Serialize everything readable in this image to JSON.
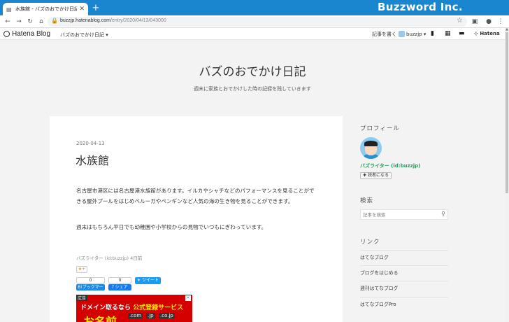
{
  "browser": {
    "tab_title": "水族館 - バズのおでかけ日記",
    "new_tab": "+",
    "brand": "Buzzword Inc.",
    "url_host": "buzzjp.hatenablog.com",
    "url_path": "/entry/2020/04/13/043000"
  },
  "hatena_bar": {
    "logo": "Hatena Blog",
    "blog_menu": "バズのおでかけ日記",
    "write_article": "記事を書く",
    "user": "buzzjp",
    "hatena": "Hatena"
  },
  "blog": {
    "title": "バズのおでかけ日記",
    "description": "週末に家族とおでかけした時の記録を残していきます"
  },
  "entry": {
    "date": "2020-04-13",
    "title": "水族館",
    "paragraph1": "名古屋市港区には名古屋港水族館があります。イルカやシャチなどのパフォーマンスを見ることができる屋外プールをはじめベルーガやペンギンなど人気の海の生き物を見ることができます。",
    "paragraph2": "週末はもちろん平日でも幼稚園や小学校からの見物でいつもにぎわっています。",
    "author_line": "バズライター (id:buzzjp) 4日前",
    "star": "★+",
    "bookmark_count": "0",
    "bookmark_label": "B!ブックマーク",
    "facebook_count": "0",
    "facebook_label": "f シェア",
    "tweet_label": "ツイート"
  },
  "ad": {
    "tag": "広告",
    "line1_a": "ドメイン取るなら",
    "line1_b": "公式登録サービス",
    "brand": "お名前",
    "tld1": ".com",
    "tld2": ".jp",
    "tld3": ".co.jp"
  },
  "sidebar": {
    "profile_heading": "プロフィール",
    "profile_name": "バズライター (id:buzzjp)",
    "follow_label": "読者になる",
    "search_heading": "検索",
    "search_placeholder": "記事を検索",
    "links_heading": "リンク",
    "links": [
      "はてなブログ",
      "ブログをはじめる",
      "週刊はてなブログ",
      "はてなブログPro"
    ]
  },
  "colors": {
    "titlebar": "#1a86d0",
    "profile_name": "#2a9d5c",
    "ad_red": "#d40000",
    "tweet_blue": "#1d9bf0",
    "bookmark_blue": "#1e88e5",
    "facebook_blue": "#1877f2"
  },
  "icons": {
    "favicon": "blog-favicon-icon",
    "back": "arrow-left-icon",
    "forward": "arrow-right-icon",
    "reload": "reload-icon",
    "home": "home-icon",
    "lock": "lock-icon",
    "bookmark_star": "star-icon",
    "search": "magnifier-icon"
  }
}
